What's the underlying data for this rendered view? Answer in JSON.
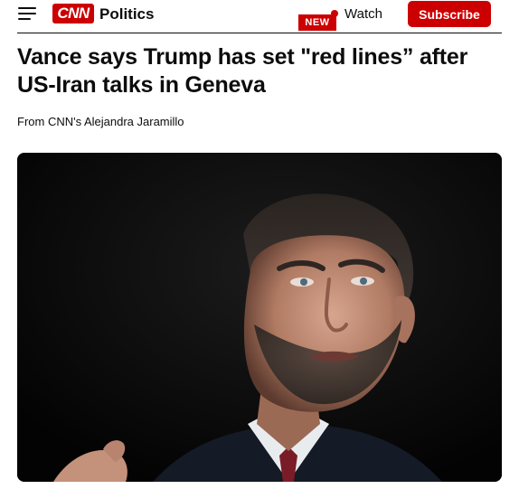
{
  "header": {
    "menu_icon": "hamburger-menu-icon",
    "brand": "CNN",
    "section": "Politics",
    "badge": "NEW",
    "watch_label": "Watch",
    "subscribe_label": "Subscribe",
    "brand_color": "#cc0000"
  },
  "article": {
    "headline": "Vance says Trump has set \"red lines” after US-Iran talks in Geneva",
    "byline": "From CNN's Alejandra Jaramillo"
  }
}
